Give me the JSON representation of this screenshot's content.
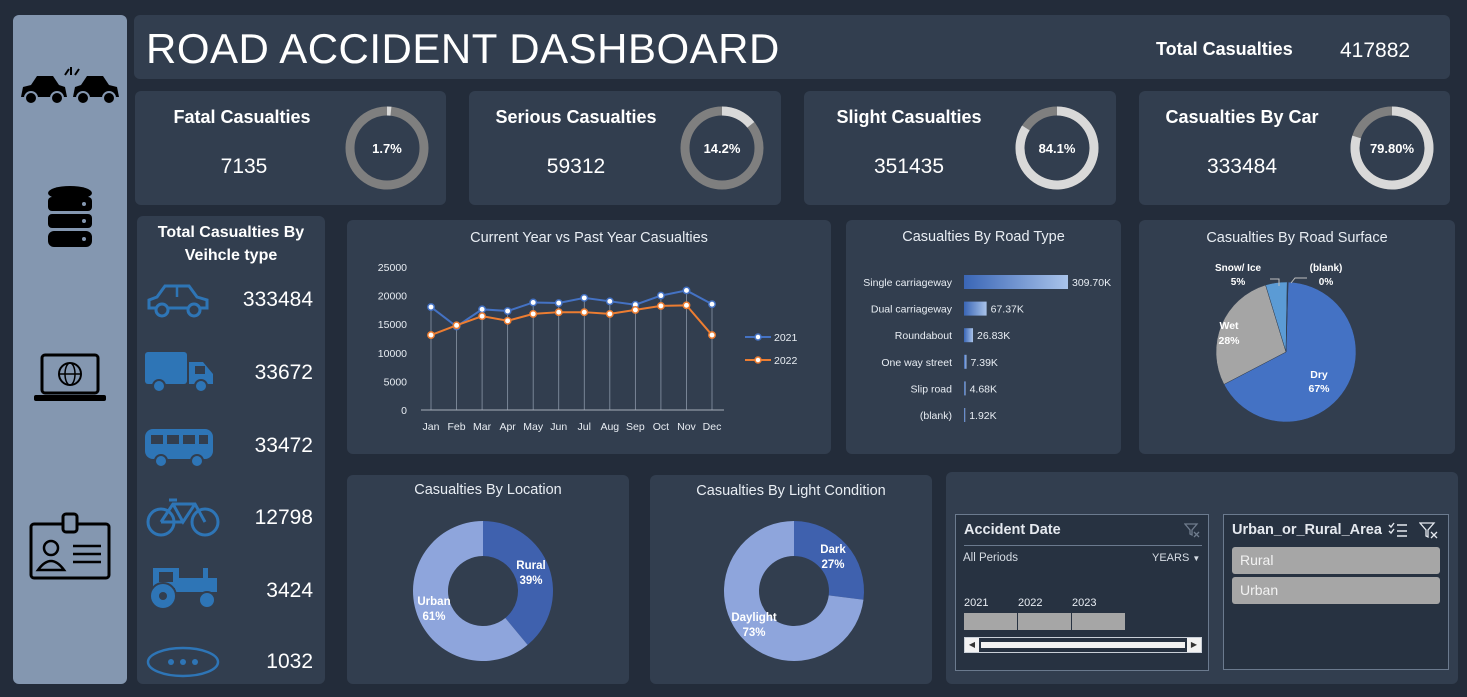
{
  "header": {
    "title": "ROAD ACCIDENT DASHBOARD",
    "total_label": "Total Casualties",
    "total_value": "417882"
  },
  "kpis": [
    {
      "label": "Fatal Casualties",
      "value": "7135",
      "pct_label": "1.7%",
      "pct": 0.017
    },
    {
      "label": "Serious Casualties",
      "value": "59312",
      "pct_label": "14.2%",
      "pct": 0.142
    },
    {
      "label": "Slight Casualties",
      "value": "351435",
      "pct_label": "84.1%",
      "pct": 0.841
    },
    {
      "label": "Casualties By Car",
      "value": "333484",
      "pct_label": "79.80%",
      "pct": 0.798
    }
  ],
  "vehicles": {
    "title": "Total Casualties By Veihcle type",
    "items": [
      {
        "icon": "car-icon",
        "value": "333484"
      },
      {
        "icon": "truck-icon",
        "value": "33672"
      },
      {
        "icon": "bus-icon",
        "value": "33472"
      },
      {
        "icon": "bicycle-icon",
        "value": "12798"
      },
      {
        "icon": "tractor-icon",
        "value": "3424"
      },
      {
        "icon": "other-icon",
        "value": "1032"
      }
    ]
  },
  "sidebar": {
    "icons": [
      "car-crash-icon",
      "database-icon",
      "laptop-globe-icon",
      "id-card-icon"
    ]
  },
  "charts": {
    "line": {
      "title": "Current Year vs Past Year Casualties"
    },
    "road_type": {
      "title": "Casualties By Road Type"
    },
    "road_surface": {
      "title": "Casualties By Road Surface"
    },
    "location": {
      "title": "Casualties By Location"
    },
    "light": {
      "title": "Casualties By Light Condition"
    }
  },
  "chart_data": [
    {
      "type": "line",
      "title": "Current Year vs Past Year Casualties",
      "categories": [
        "Jan",
        "Feb",
        "Mar",
        "Apr",
        "May",
        "Jun",
        "Jul",
        "Aug",
        "Sep",
        "Oct",
        "Nov",
        "Dec"
      ],
      "ylim": [
        0,
        25000
      ],
      "yticks": [
        "0",
        "5000",
        "10000",
        "15000",
        "20000",
        "25000"
      ],
      "legend": "right",
      "series": [
        {
          "name": "2021",
          "color": "#4472c4",
          "values": [
            18000,
            14600,
            17600,
            17300,
            18800,
            18700,
            19600,
            19000,
            18400,
            20000,
            20900,
            18500
          ]
        },
        {
          "name": "2022",
          "color": "#ed7d31",
          "values": [
            13100,
            14800,
            16400,
            15600,
            16800,
            17100,
            17100,
            16800,
            17500,
            18200,
            18300,
            13100
          ]
        }
      ]
    },
    {
      "type": "bar",
      "title": "Casualties By Road Type",
      "categories": [
        "Single carriageway",
        "Dual carriageway",
        "Roundabout",
        "One way street",
        "Slip road",
        "(blank)"
      ],
      "values": [
        309700,
        67370,
        26830,
        7390,
        4680,
        1920
      ],
      "labels": [
        "309.70K",
        "67.37K",
        "26.83K",
        "7.39K",
        "4.68K",
        "1.92K"
      ]
    },
    {
      "type": "pie",
      "title": "Casualties By Road Surface",
      "slices": [
        {
          "label": "Dry",
          "pct_label": "67%",
          "value": 67,
          "color": "#4472c4"
        },
        {
          "label": "Wet",
          "pct_label": "28%",
          "value": 28,
          "color": "#a5a5a5"
        },
        {
          "label": "Snow/ Ice",
          "pct_label": "5%",
          "value": 5,
          "color": "#5b9bd5"
        },
        {
          "label": "(blank)",
          "pct_label": "0%",
          "value": 0.2,
          "color": "#264478"
        }
      ]
    },
    {
      "type": "pie",
      "title": "Casualties By Location",
      "slices": [
        {
          "label": "Rural",
          "pct_label": "39%",
          "value": 39,
          "color": "#3f61ae"
        },
        {
          "label": "Urban",
          "pct_label": "61%",
          "value": 61,
          "color": "#8ea5dc"
        }
      ]
    },
    {
      "type": "pie",
      "title": "Casualties By Light Condition",
      "slices": [
        {
          "label": "Dark",
          "pct_label": "27%",
          "value": 27,
          "color": "#3f61ae"
        },
        {
          "label": "Daylight",
          "pct_label": "73%",
          "value": 73,
          "color": "#8ea5dc"
        }
      ]
    }
  ],
  "slicers": {
    "date": {
      "title": "Accident Date",
      "period": "All Periods",
      "unit": "YEARS",
      "years": [
        "2021",
        "2022",
        "2023"
      ]
    },
    "area": {
      "title": "Urban_or_Rural_Area",
      "items": [
        "Rural",
        "Urban"
      ]
    }
  },
  "colors": {
    "background": "#232c3a",
    "panel": "#323e4f",
    "sidebar": "#8497b0",
    "accent": "#4472c4"
  }
}
